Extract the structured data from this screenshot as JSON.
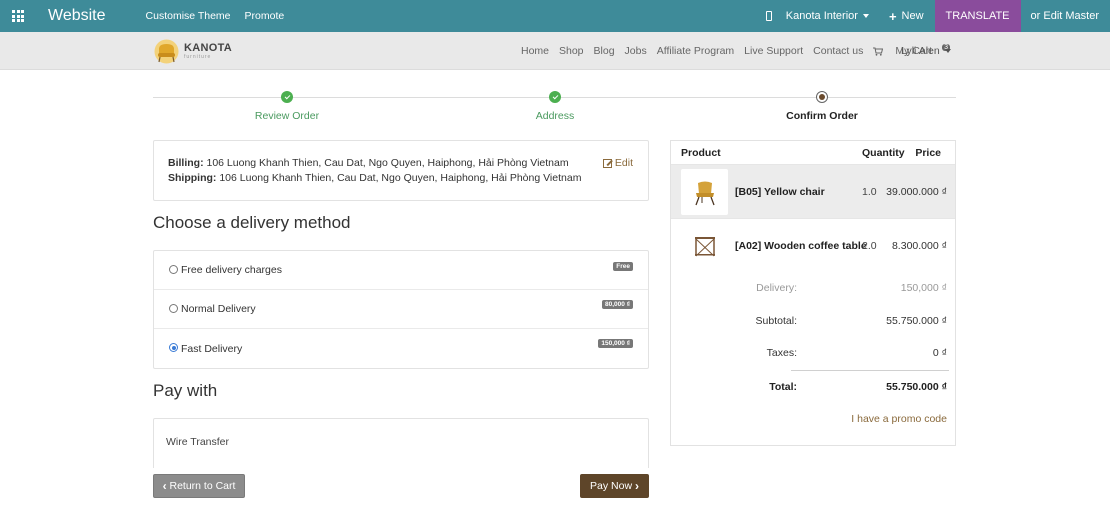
{
  "topbar": {
    "brand": "Website",
    "menu": [
      "Customise Theme",
      "Promote"
    ],
    "website_name": "Kanota Interior",
    "new_label": "New",
    "translate_label": "TRANSLATE",
    "edit_master_label": "or Edit Master",
    "bg_color": "#3e8b99",
    "translate_color": "#8a4c9c"
  },
  "header": {
    "logo_name": "KANOTA",
    "logo_sub": "furniture",
    "nav": [
      "Home",
      "Shop",
      "Blog",
      "Jobs",
      "Affiliate Program",
      "Live Support",
      "Contact us"
    ],
    "cart_label": "My Cart",
    "cart_count": "3",
    "user_name": "Lyli Alen"
  },
  "steps": [
    {
      "label": "Review Order",
      "state": "done"
    },
    {
      "label": "Address",
      "state": "done"
    },
    {
      "label": "Confirm Order",
      "state": "current"
    }
  ],
  "address": {
    "billing_label": "Billing:",
    "billing_value": "106 Luong Khanh Thien, Cau Dat, Ngo Quyen, Haiphong, Hải Phòng Vietnam",
    "shipping_label": "Shipping:",
    "shipping_value": "106 Luong Khanh Thien, Cau Dat, Ngo Quyen, Haiphong, Hải Phòng Vietnam",
    "edit_label": "Edit"
  },
  "delivery": {
    "title": "Choose a delivery method",
    "methods": [
      {
        "label": "Free delivery charges",
        "price": "Free",
        "selected": false
      },
      {
        "label": "Normal Delivery",
        "price": "80,000 ₫",
        "selected": false
      },
      {
        "label": "Fast Delivery",
        "price": "150,000 ₫",
        "selected": true
      }
    ]
  },
  "payment": {
    "title": "Pay with",
    "method": "Wire Transfer",
    "return_label": "Return to Cart",
    "pay_label": "Pay Now"
  },
  "summary": {
    "headers": {
      "product": "Product",
      "quantity": "Quantity",
      "price": "Price"
    },
    "items": [
      {
        "name": "[B05] Yellow chair",
        "qty": "1.0",
        "price": "39.000.000 ₫",
        "image": "yellow-chair-image"
      },
      {
        "name": "[A02] Wooden coffee table",
        "qty": "2.0",
        "price": "8.300.000 ₫",
        "image": "wooden-table-image"
      }
    ],
    "delivery_label": "Delivery:",
    "delivery_value": "150,000 ₫",
    "subtotal_label": "Subtotal:",
    "subtotal_value": "55.750.000 ₫",
    "taxes_label": "Taxes:",
    "taxes_value": "0 ₫",
    "total_label": "Total:",
    "total_value": "55.750.000 ₫",
    "promo_label": "I have a promo code"
  }
}
